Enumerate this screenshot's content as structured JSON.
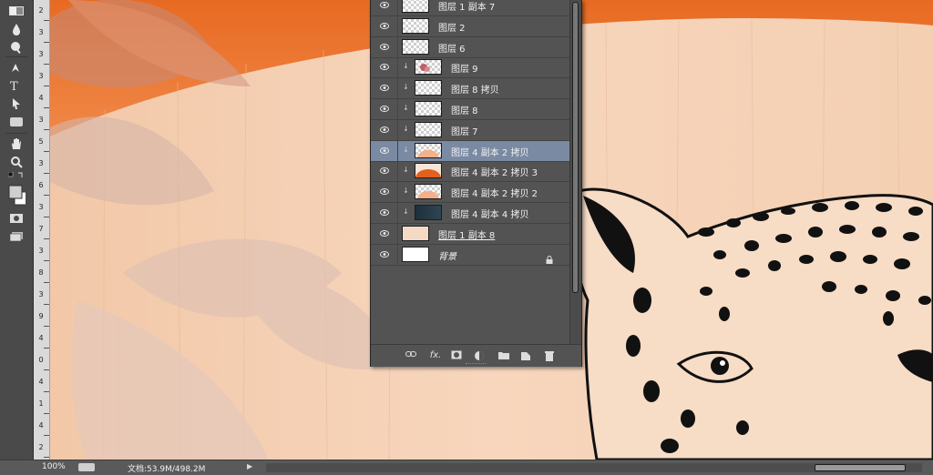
{
  "tools": [
    {
      "icon": "gradient-tool-icon"
    },
    {
      "icon": "blur-drop-icon"
    },
    {
      "icon": "dodge-tool-icon"
    },
    {
      "icon": "pen-tool-icon"
    },
    {
      "icon": "type-tool-icon"
    },
    {
      "icon": "path-selection-icon"
    },
    {
      "icon": "rectangle-tool-icon"
    },
    {
      "icon": "hand-tool-icon"
    },
    {
      "icon": "zoom-tool-icon"
    },
    {
      "icon": "swap-colors-icon"
    },
    {
      "icon": "color-swatches-icon"
    },
    {
      "icon": "quick-mask-icon"
    },
    {
      "icon": "screen-mode-icon"
    }
  ],
  "ruler": {
    "labels": [
      "2",
      "3",
      "3",
      "3",
      "4",
      "3",
      "5",
      "3",
      "6",
      "3",
      "7",
      "3",
      "8",
      "3",
      "9",
      "4",
      "0",
      "4",
      "1",
      "4",
      "2"
    ]
  },
  "layers_panel": {
    "layers": [
      {
        "name": "图层 1 副本 7",
        "thumb": "checker",
        "clipped": false,
        "selected": false
      },
      {
        "name": "图层 2",
        "thumb": "checker",
        "clipped": false,
        "selected": false
      },
      {
        "name": "图层 6",
        "thumb": "checker",
        "clipped": false,
        "selected": false
      },
      {
        "name": "图层 9",
        "thumb": "flower",
        "clipped": true,
        "selected": false
      },
      {
        "name": "图层 8 拷贝",
        "thumb": "checker",
        "clipped": true,
        "selected": false
      },
      {
        "name": "图层 8",
        "thumb": "checker",
        "clipped": true,
        "selected": false
      },
      {
        "name": "图层 7",
        "thumb": "checker",
        "clipped": true,
        "selected": false
      },
      {
        "name": "图层 4 副本 2 拷贝",
        "thumb": "peach-arc",
        "clipped": true,
        "selected": true
      },
      {
        "name": "图层 4 副本 2 拷贝 3",
        "thumb": "orange-arc",
        "clipped": true,
        "selected": false
      },
      {
        "name": "图层 4 副本 2 拷贝 2",
        "thumb": "peach-arc",
        "clipped": true,
        "selected": false
      },
      {
        "name": "图层 4 副本 4 拷贝",
        "thumb": "dark",
        "clipped": true,
        "selected": false
      },
      {
        "name": "图层 1 副本 8",
        "thumb": "wood",
        "clipped": false,
        "selected": false,
        "underline": true
      },
      {
        "name": "背景",
        "thumb": "white",
        "clipped": false,
        "selected": false,
        "italic": true,
        "locked": true
      }
    ],
    "footer_icons": [
      "link-layers-icon",
      "fx-icon",
      "add-mask-icon",
      "adjustment-layer-icon",
      "new-group-icon",
      "new-layer-icon",
      "delete-layer-icon"
    ],
    "fx_label": "fx."
  },
  "status_bar": {
    "zoom": "100%",
    "doc_info": "文档:53.9M/498.2M"
  },
  "colors": {
    "ui_dark": "#535353",
    "selected_layer": "#7a8aa3",
    "orange_band": "#ef7d3a",
    "wood_light": "#f6d2b5"
  }
}
